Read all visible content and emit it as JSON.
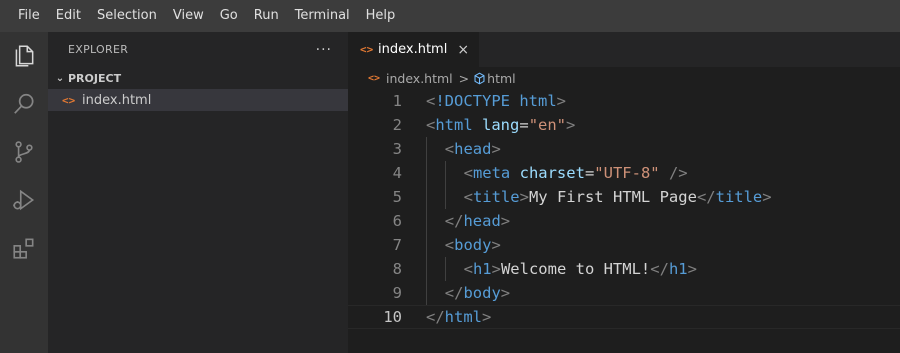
{
  "menu": [
    "File",
    "Edit",
    "Selection",
    "View",
    "Go",
    "Run",
    "Terminal",
    "Help"
  ],
  "activity": [
    "explorer-icon",
    "search-icon",
    "source-control-icon",
    "run-debug-icon",
    "extensions-icon"
  ],
  "sidebar": {
    "title": "EXPLORER",
    "more": "···",
    "section": "PROJECT",
    "files": [
      {
        "name": "index.html",
        "icon": "<>"
      }
    ]
  },
  "editor": {
    "tab": {
      "label": "index.html",
      "icon": "<>",
      "close": "×"
    },
    "breadcrumb": {
      "file": "index.html",
      "separator": ">",
      "symbol": "html"
    },
    "active_line": 10,
    "lines": [
      {
        "num": "1",
        "indent": 0,
        "tokens": [
          [
            "br",
            "<"
          ],
          [
            "tag",
            "!DOCTYPE"
          ],
          [
            "txt",
            " "
          ],
          [
            "tag",
            "html"
          ],
          [
            "br",
            ">"
          ]
        ]
      },
      {
        "num": "2",
        "indent": 0,
        "tokens": [
          [
            "br",
            "<"
          ],
          [
            "tag",
            "html"
          ],
          [
            "txt",
            " "
          ],
          [
            "attr",
            "lang"
          ],
          [
            "txt",
            "="
          ],
          [
            "str",
            "\"en\""
          ],
          [
            "br",
            ">"
          ]
        ]
      },
      {
        "num": "3",
        "indent": 1,
        "tokens": [
          [
            "br",
            "<"
          ],
          [
            "tag",
            "head"
          ],
          [
            "br",
            ">"
          ]
        ]
      },
      {
        "num": "4",
        "indent": 2,
        "tokens": [
          [
            "br",
            "<"
          ],
          [
            "tag",
            "meta"
          ],
          [
            "txt",
            " "
          ],
          [
            "attr",
            "charset"
          ],
          [
            "txt",
            "="
          ],
          [
            "str",
            "\"UTF-8\""
          ],
          [
            "txt",
            " "
          ],
          [
            "br",
            "/>"
          ]
        ]
      },
      {
        "num": "5",
        "indent": 2,
        "tokens": [
          [
            "br",
            "<"
          ],
          [
            "tag",
            "title"
          ],
          [
            "br",
            ">"
          ],
          [
            "txt",
            "My First HTML Page"
          ],
          [
            "br",
            "</"
          ],
          [
            "tag",
            "title"
          ],
          [
            "br",
            ">"
          ]
        ]
      },
      {
        "num": "6",
        "indent": 1,
        "tokens": [
          [
            "br",
            "</"
          ],
          [
            "tag",
            "head"
          ],
          [
            "br",
            ">"
          ]
        ]
      },
      {
        "num": "7",
        "indent": 1,
        "tokens": [
          [
            "br",
            "<"
          ],
          [
            "tag",
            "body"
          ],
          [
            "br",
            ">"
          ]
        ]
      },
      {
        "num": "8",
        "indent": 2,
        "tokens": [
          [
            "br",
            "<"
          ],
          [
            "tag",
            "h1"
          ],
          [
            "br",
            ">"
          ],
          [
            "txt",
            "Welcome to HTML!"
          ],
          [
            "br",
            "</"
          ],
          [
            "tag",
            "h1"
          ],
          [
            "br",
            ">"
          ]
        ]
      },
      {
        "num": "9",
        "indent": 1,
        "tokens": [
          [
            "br",
            "</"
          ],
          [
            "tag",
            "body"
          ],
          [
            "br",
            ">"
          ]
        ]
      },
      {
        "num": "10",
        "indent": 0,
        "tokens": [
          [
            "br",
            "</"
          ],
          [
            "tag",
            "html"
          ],
          [
            "br",
            ">"
          ]
        ]
      }
    ]
  }
}
